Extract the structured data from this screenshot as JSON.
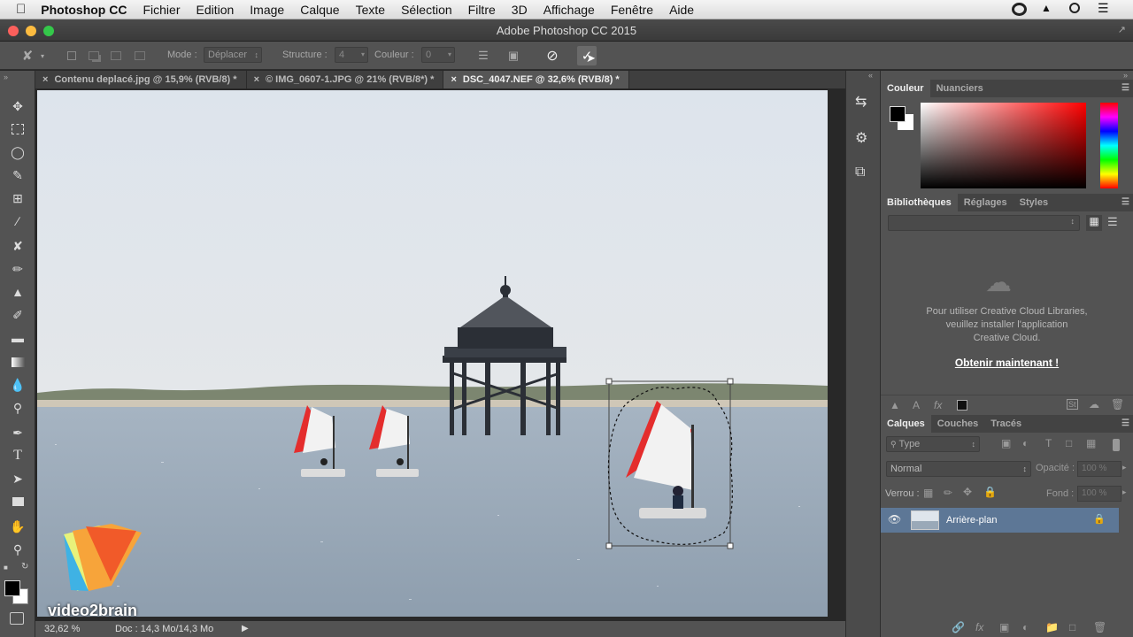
{
  "menubar": {
    "apple_glyph": "",
    "app": "Photoshop CC",
    "items": [
      "Fichier",
      "Edition",
      "Image",
      "Calque",
      "Texte",
      "Sélection",
      "Filtre",
      "3D",
      "Affichage",
      "Fenêtre",
      "Aide"
    ]
  },
  "titlebar": {
    "title": "Adobe Photoshop CC 2015"
  },
  "options": {
    "mode_label": "Mode :",
    "mode_value": "Déplacer",
    "structure_label": "Structure :",
    "structure_value": "4",
    "couleur_label": "Couleur :",
    "couleur_value": "0"
  },
  "tabs": [
    {
      "label": "Contenu deplacé.jpg @ 15,9% (RVB/8) *",
      "close": "×"
    },
    {
      "label": "© IMG_0607-1.JPG @ 21% (RVB/8*) *",
      "close": "×"
    },
    {
      "label": "DSC_4047.NEF @ 32,6% (RVB/8) *",
      "close": "×"
    }
  ],
  "status": {
    "zoom": "32,62 %",
    "doc": "Doc : 14,3 Mo/14,3 Mo"
  },
  "watermark": {
    "text": "video2brain"
  },
  "color_panel": {
    "tabs": [
      "Couleur",
      "Nuanciers"
    ]
  },
  "libraries_panel": {
    "tabs": [
      "Bibliothèques",
      "Réglages",
      "Styles"
    ],
    "message": [
      "Pour utiliser Creative Cloud Libraries,",
      "veuillez installer l'application",
      "Creative Cloud."
    ],
    "link": "Obtenir maintenant !"
  },
  "layers_panel": {
    "tabs": [
      "Calques",
      "Couches",
      "Tracés"
    ],
    "filter_value": "Type",
    "blend_value": "Normal",
    "opacity_label": "Opacité :",
    "opacity_value": "100 %",
    "lock_label": "Verrou :",
    "fill_label": "Fond :",
    "fill_value": "100 %",
    "layer_name": "Arrière-plan"
  },
  "colors": {
    "accent_selected_layer": "#5d7796",
    "panel": "#535353",
    "dark": "#282828"
  }
}
